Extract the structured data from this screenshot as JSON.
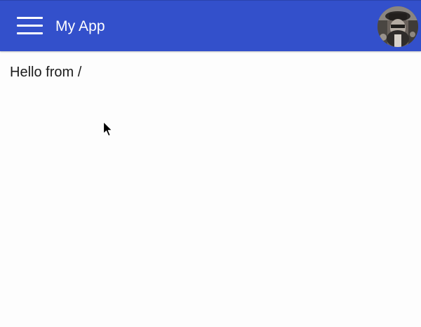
{
  "app_bar": {
    "title": "My App",
    "menu_icon": "hamburger-menu-icon",
    "avatar_icon": "user-avatar",
    "background_color": "#3350cb",
    "text_color": "#ffffff"
  },
  "main": {
    "text": "Hello from /"
  },
  "cursor_icon": "mouse-pointer-icon"
}
